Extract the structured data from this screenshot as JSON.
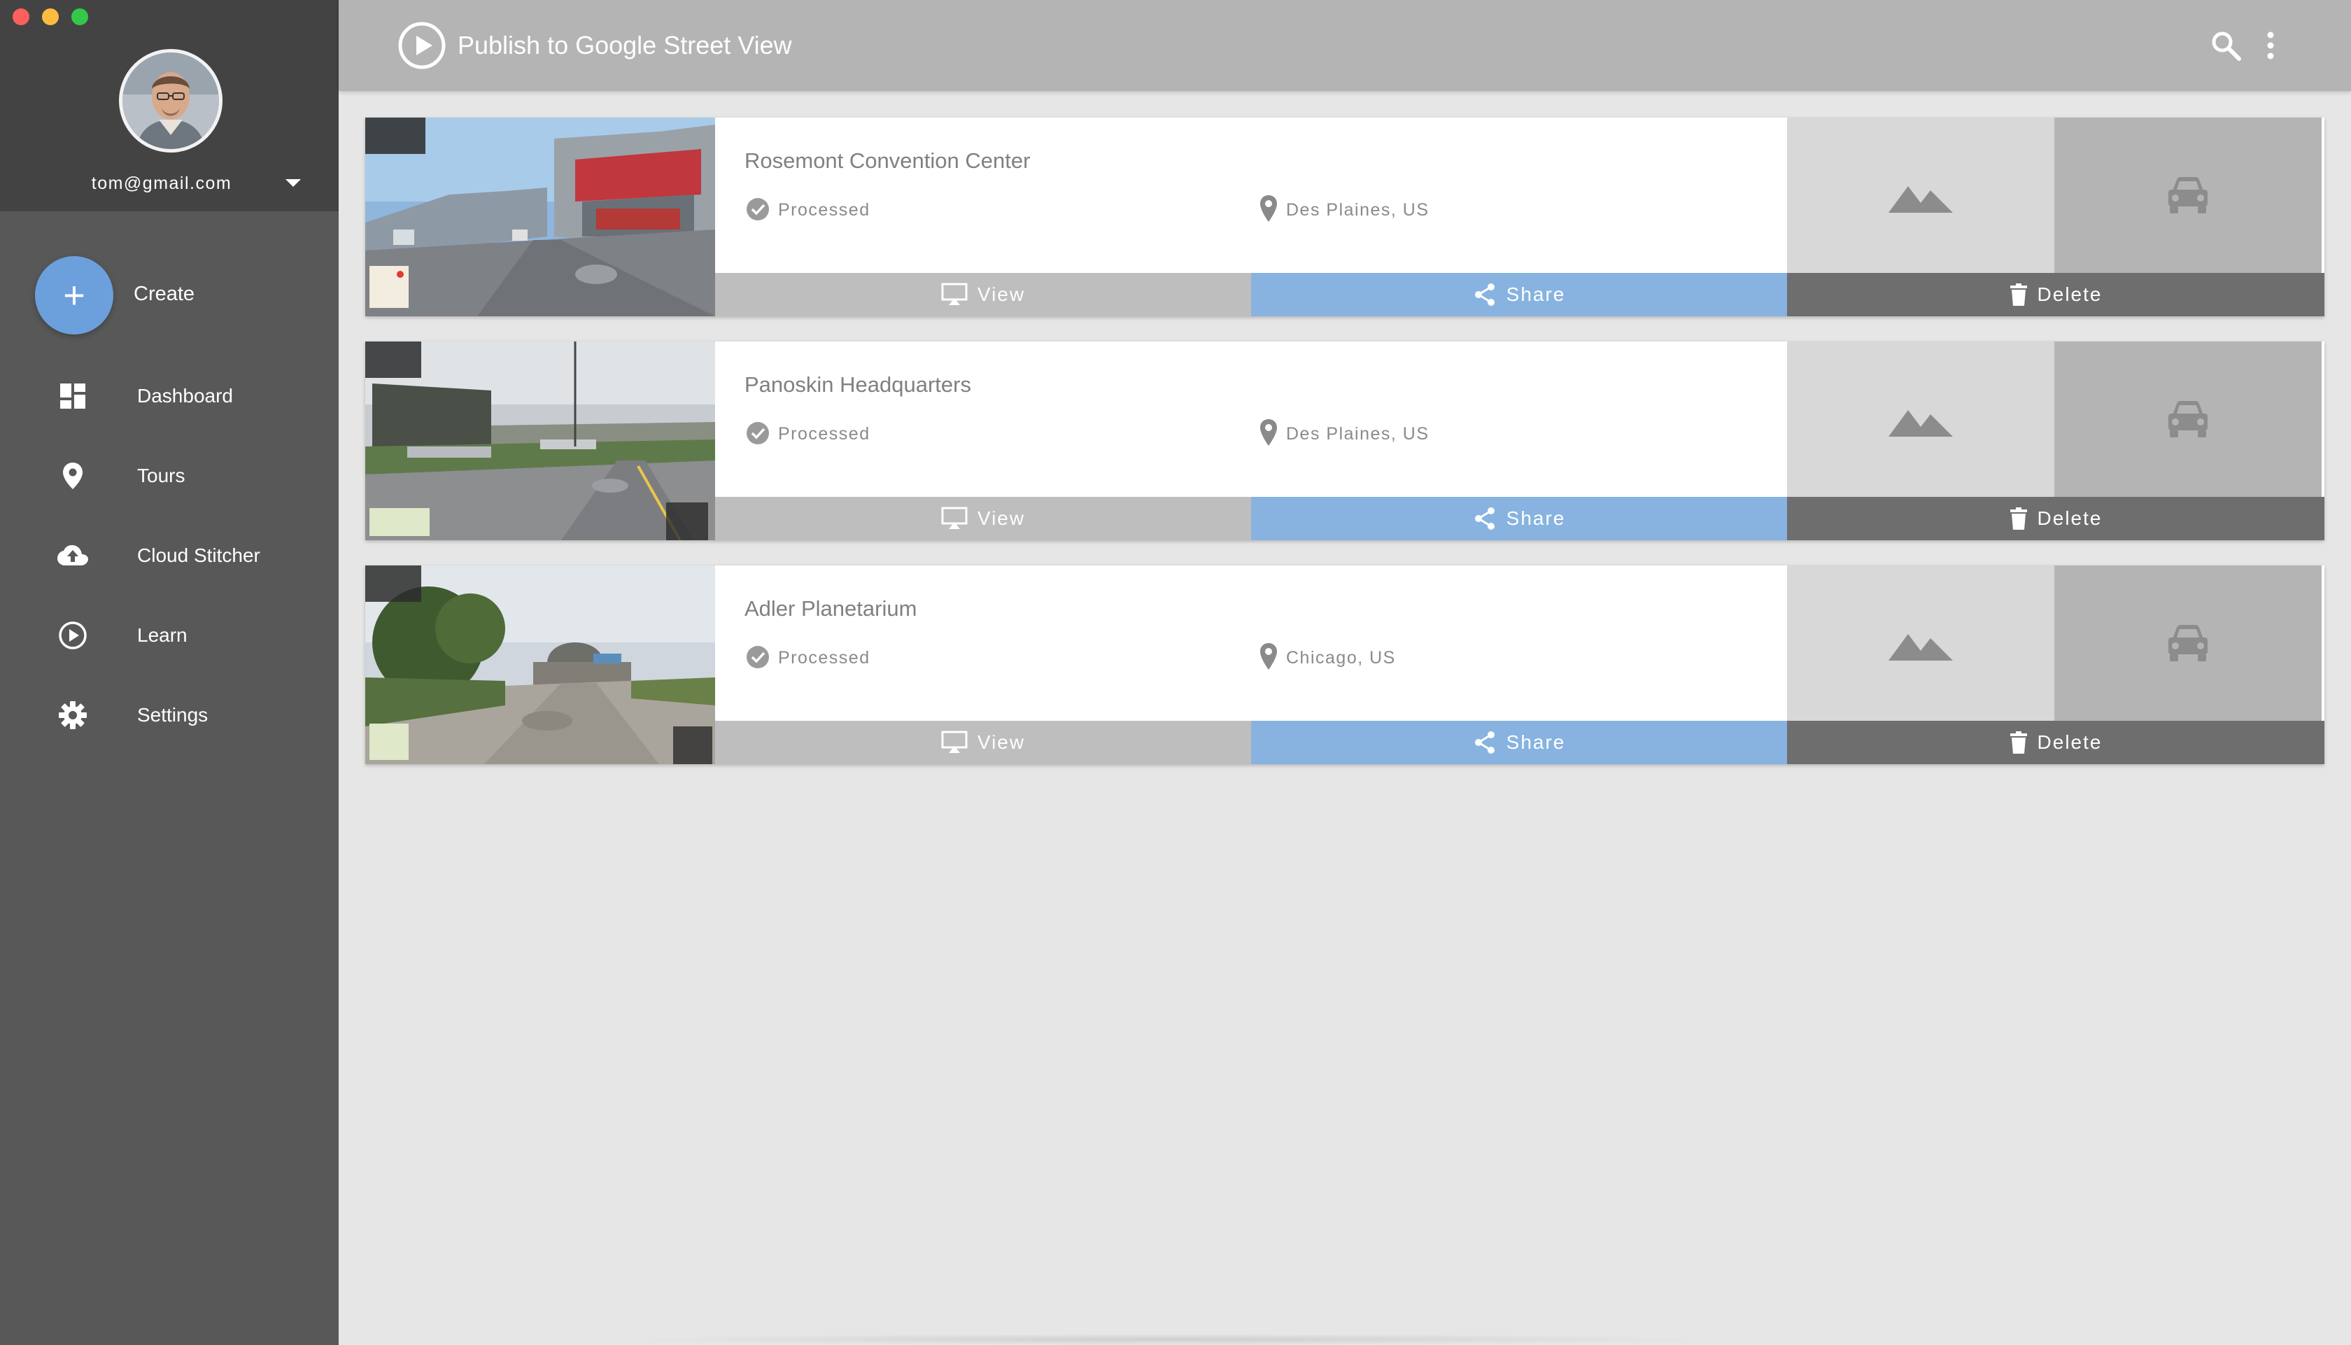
{
  "window": {
    "controls": [
      "close",
      "minimize",
      "zoom"
    ]
  },
  "sidebar": {
    "account": {
      "email": "tom@gmail.com",
      "avatar_icon": "user-avatar",
      "menu_icon": "caret-down-icon"
    },
    "create": {
      "label": "Create",
      "icon": "plus-icon",
      "color": "#6ca0dc"
    },
    "items": [
      {
        "label": "Dashboard",
        "icon": "dashboard-icon"
      },
      {
        "label": "Tours",
        "icon": "map-pin-icon"
      },
      {
        "label": "Cloud Stitcher",
        "icon": "cloud-upload-icon"
      },
      {
        "label": "Learn",
        "icon": "play-circle-icon"
      },
      {
        "label": "Settings",
        "icon": "gear-icon"
      }
    ]
  },
  "header": {
    "title": "Publish to Google Street View",
    "icon": "play-circle-icon",
    "actions": [
      "search-icon",
      "more-vert-icon"
    ]
  },
  "tours": [
    {
      "title": "Rosemont Convention Center",
      "status": "Processed",
      "location": "Des Plaines, US",
      "actions": {
        "view": "View",
        "share": "Share",
        "delete": "Delete"
      }
    },
    {
      "title": "Panoskin Headquarters",
      "status": "Processed",
      "location": "Des Plaines, US",
      "actions": {
        "view": "View",
        "share": "Share",
        "delete": "Delete"
      }
    },
    {
      "title": "Adler Planetarium",
      "status": "Processed",
      "location": "Chicago, US",
      "actions": {
        "view": "View",
        "share": "Share",
        "delete": "Delete"
      }
    }
  ],
  "colors": {
    "sidebar": "#585858",
    "sidebar_profile": "#434343",
    "header": "#b4b4b4",
    "share": "#88b3e0",
    "view": "#bebebe",
    "delete": "#6e6e6e",
    "background": "#e6e6e6"
  }
}
